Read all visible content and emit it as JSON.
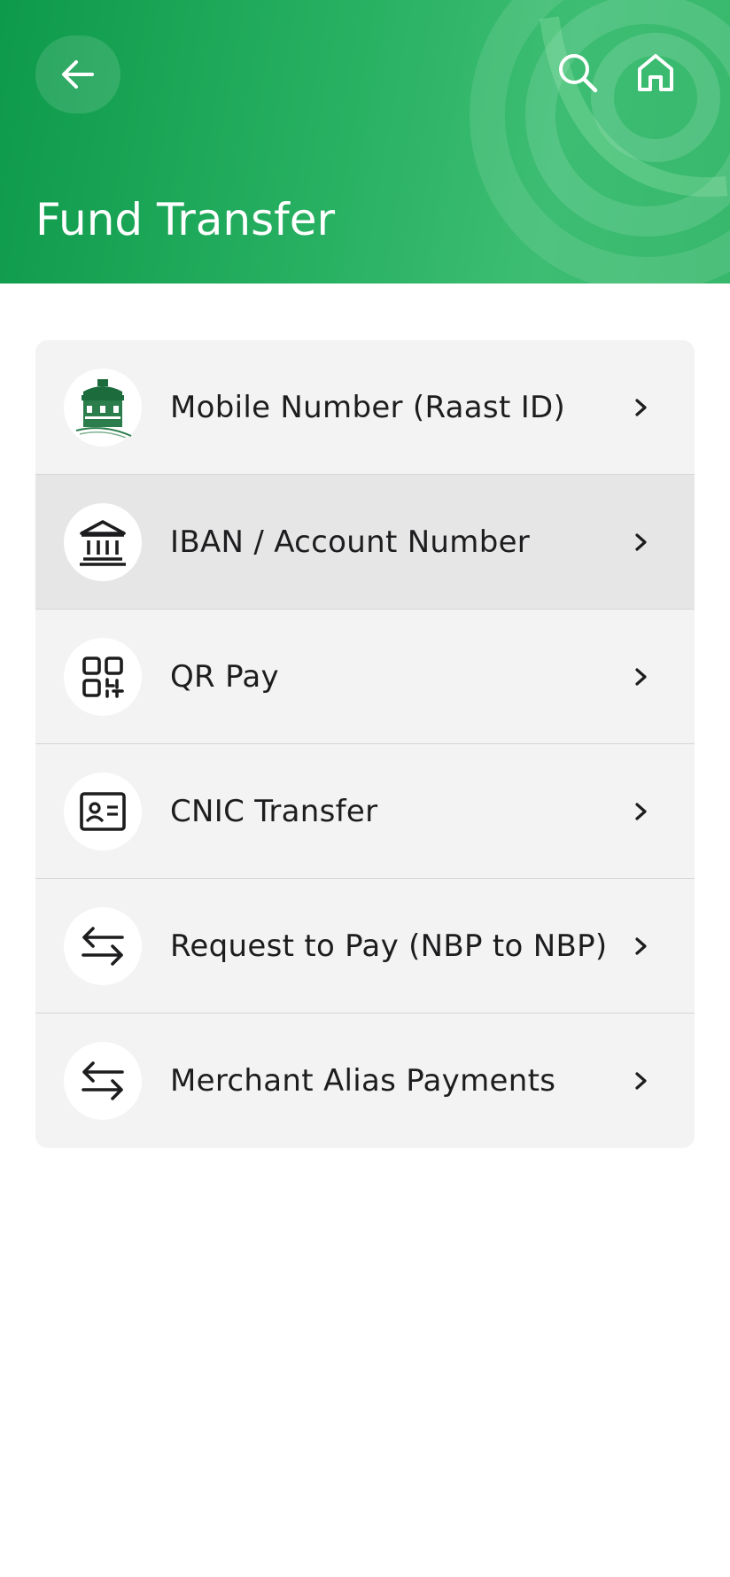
{
  "header": {
    "title": "Fund Transfer",
    "color": "#1aa357"
  },
  "options": [
    {
      "label": "Mobile Number (Raast ID)",
      "icon": "bank-logo-icon"
    },
    {
      "label": "IBAN / Account Number",
      "icon": "bank-building-icon",
      "selected": true
    },
    {
      "label": "QR Pay",
      "icon": "qr-code-icon"
    },
    {
      "label": "CNIC Transfer",
      "icon": "id-card-icon"
    },
    {
      "label": "Request to Pay (NBP to NBP)",
      "icon": "transfer-arrows-icon"
    },
    {
      "label": "Merchant Alias Payments",
      "icon": "transfer-arrows-icon"
    }
  ]
}
